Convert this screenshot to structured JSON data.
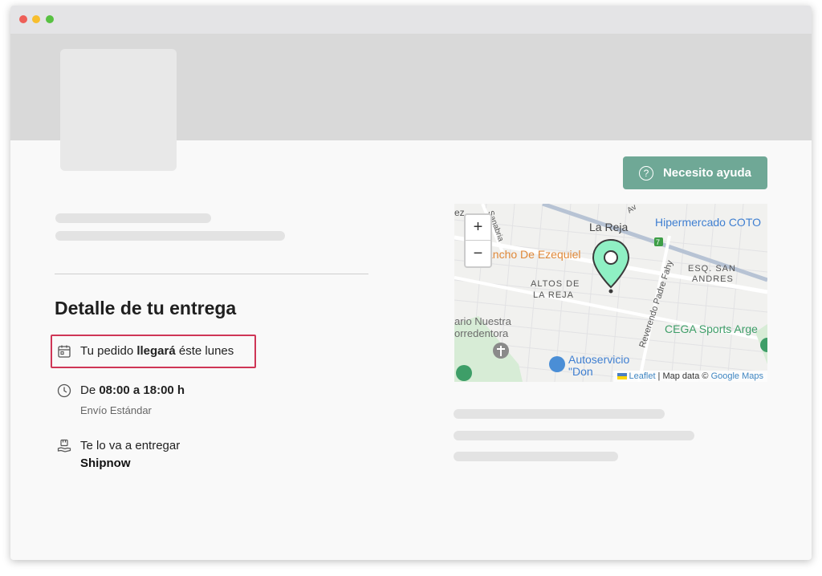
{
  "header": {
    "help_label": "Necesito ayuda"
  },
  "delivery": {
    "title": "Detalle de tu entrega",
    "arrival_prefix": "Tu pedido ",
    "arrival_bold": "llegará",
    "arrival_suffix": " éste lunes",
    "time_prefix": "De ",
    "time_range": "08:00 a 18:00 h",
    "shipping_type": "Envío Estándar",
    "carrier_label": "Te lo va a entregar",
    "carrier_name": "Shipnow"
  },
  "map": {
    "zoom_in": "+",
    "zoom_out": "−",
    "labels": {
      "la_reja": "La Reja",
      "hipermercado": "Hipermercado COTO",
      "rancho": "ancho De Ezequiel",
      "altos1": "ALTOS DE",
      "altos2": "LA REJA",
      "esq1": "ESQ. SAN",
      "esq2": "ANDRES",
      "rosario1": "ario Nuestra",
      "rosario2": "orredentora",
      "cega": "CEGA Sports Arge",
      "auto1": "Autoservicio",
      "auto2": "\"Don",
      "fahy": "Reverendo Padre Fahy",
      "sanabria": "Sanabria",
      "ez": "ez",
      "av": "Av",
      "route": "7"
    },
    "attribution": {
      "leaflet": "Leaflet",
      "sep1": " | Map data © ",
      "google": "Google Maps"
    }
  },
  "colors": {
    "accent": "#6fa896",
    "highlight": "#cf3656",
    "pin": "#8ff0c4"
  }
}
